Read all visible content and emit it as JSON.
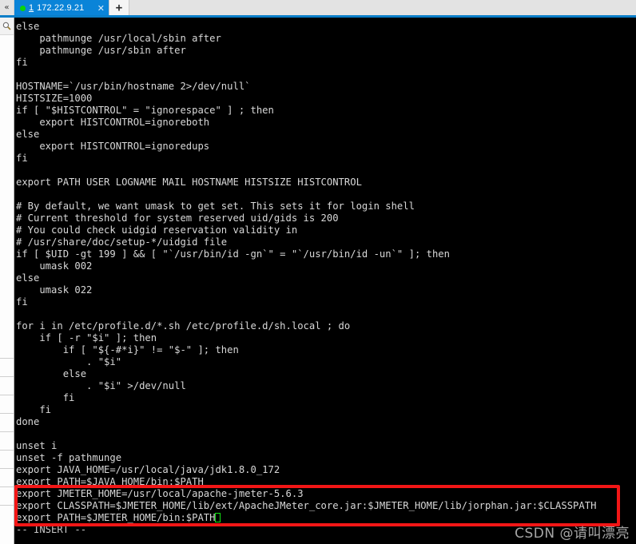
{
  "window": {
    "sidebar_toggle_icon": "chevron-left-icon",
    "search_icon": "magnifier-icon",
    "new_tab_icon": "plus-icon",
    "accent_color": "#0a7ec8",
    "tab_active_color": "#0a84d8",
    "terminal_bg": "#000000",
    "terminal_fg": "#d8d8d8",
    "annotation_color": "#f21616",
    "cursor_color": "#12e012"
  },
  "tabs": [
    {
      "index": "1",
      "label": "172.22.9.21",
      "status_dot": "connected",
      "close_icon": "close-icon",
      "active": true
    }
  ],
  "sidebar": {
    "rows": [
      "",
      "",
      "",
      "",
      "",
      "",
      "",
      "",
      ""
    ]
  },
  "terminal": {
    "lines": [
      "else",
      "    pathmunge /usr/local/sbin after",
      "    pathmunge /usr/sbin after",
      "fi",
      "",
      "HOSTNAME=`/usr/bin/hostname 2>/dev/null`",
      "HISTSIZE=1000",
      "if [ \"$HISTCONTROL\" = \"ignorespace\" ] ; then",
      "    export HISTCONTROL=ignoreboth",
      "else",
      "    export HISTCONTROL=ignoredups",
      "fi",
      "",
      "export PATH USER LOGNAME MAIL HOSTNAME HISTSIZE HISTCONTROL",
      "",
      "# By default, we want umask to get set. This sets it for login shell",
      "# Current threshold for system reserved uid/gids is 200",
      "# You could check uidgid reservation validity in",
      "# /usr/share/doc/setup-*/uidgid file",
      "if [ $UID -gt 199 ] && [ \"`/usr/bin/id -gn`\" = \"`/usr/bin/id -un`\" ]; then",
      "    umask 002",
      "else",
      "    umask 022",
      "fi",
      "",
      "for i in /etc/profile.d/*.sh /etc/profile.d/sh.local ; do",
      "    if [ -r \"$i\" ]; then",
      "        if [ \"${-#*i}\" != \"$-\" ]; then",
      "            . \"$i\"",
      "        else",
      "            . \"$i\" >/dev/null",
      "        fi",
      "    fi",
      "done",
      "",
      "unset i",
      "unset -f pathmunge",
      "export JAVA_HOME=/usr/local/java/jdk1.8.0_172",
      "export PATH=$JAVA_HOME/bin:$PATH"
    ],
    "highlighted_lines": [
      "export JMETER_HOME=/usr/local/apache-jmeter-5.6.3",
      "export CLASSPATH=$JMETER_HOME/lib/ext/ApacheJMeter_core.jar:$JMETER_HOME/lib/jorphan.jar:$CLASSPATH"
    ],
    "cursor_line_prefix": "export PATH=$JMETER_HOME/bin:$PATH",
    "status_line": "-- INSERT --"
  },
  "watermark": {
    "text": "CSDN @请叫漂亮"
  }
}
